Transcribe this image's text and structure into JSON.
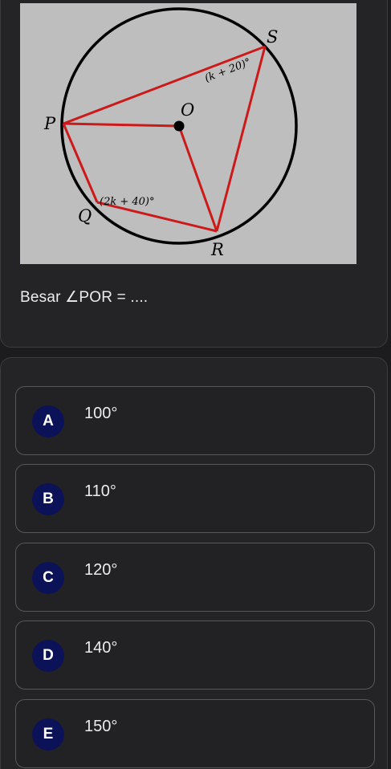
{
  "figure": {
    "labels": {
      "P": "P",
      "Q": "Q",
      "R": "R",
      "S": "S",
      "O": "O",
      "angle_S": "(k + 20)°",
      "angle_Q": "(2k + 40)°"
    },
    "colors": {
      "background": "#bebebe",
      "circle": "#000000",
      "lines": "#cc1a1a"
    }
  },
  "question": {
    "text": "Besar ∠POR = ...."
  },
  "options": [
    {
      "letter": "A",
      "value": "100°"
    },
    {
      "letter": "B",
      "value": "110°"
    },
    {
      "letter": "C",
      "value": "120°"
    },
    {
      "letter": "D",
      "value": "140°"
    },
    {
      "letter": "E",
      "value": "150°"
    }
  ],
  "colors": {
    "badge": "#0c1257",
    "card_background": "#242426",
    "page_background": "#1c1c1e"
  }
}
